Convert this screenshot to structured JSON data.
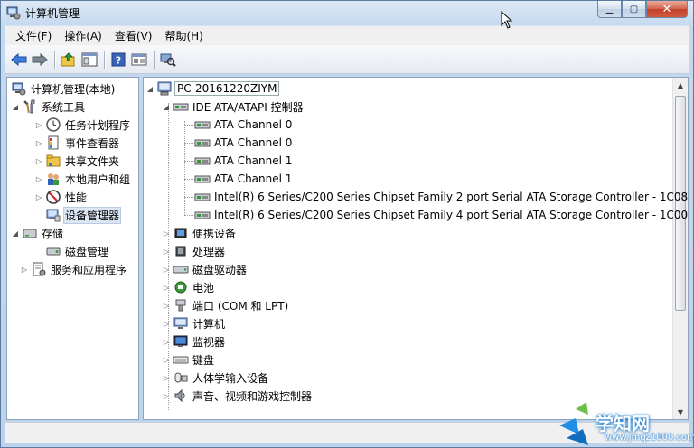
{
  "window": {
    "title": "计算机管理"
  },
  "menu": [
    "文件(F)",
    "操作(A)",
    "查看(V)",
    "帮助(H)"
  ],
  "left_tree": {
    "root": "计算机管理(本地)",
    "system_tools": "系统工具",
    "task_scheduler": "任务计划程序",
    "event_viewer": "事件查看器",
    "shared_folders": "共享文件夹",
    "local_users": "本地用户和组",
    "performance": "性能",
    "device_manager": "设备管理器",
    "storage": "存储",
    "disk_management": "磁盘管理",
    "services_apps": "服务和应用程序"
  },
  "device_tree": {
    "computer_name": "PC-20161220ZIYM",
    "ide_group": "IDE ATA/ATAPI 控制器",
    "ide_children": [
      "ATA Channel 0",
      "ATA Channel 0",
      "ATA Channel 1",
      "ATA Channel 1",
      "Intel(R) 6 Series/C200 Series Chipset Family 2 port Serial ATA Storage Controller - 1C08",
      "Intel(R) 6 Series/C200 Series Chipset Family 4 port Serial ATA Storage Controller - 1C00"
    ],
    "categories": [
      "便携设备",
      "处理器",
      "磁盘驱动器",
      "电池",
      "端口 (COM 和 LPT)",
      "计算机",
      "监视器",
      "键盘",
      "人体学输入设备",
      "声音、视频和游戏控制器"
    ]
  },
  "watermark": {
    "text": "学知网",
    "url": "www.jmqz1000.com"
  }
}
